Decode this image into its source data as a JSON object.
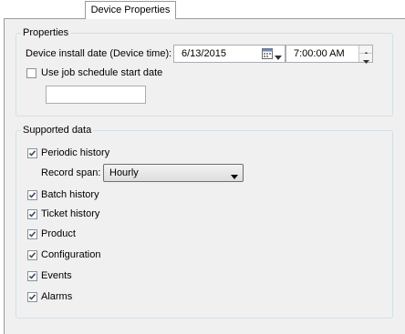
{
  "tab": {
    "label": "Device Properties"
  },
  "properties": {
    "legend": "Properties",
    "install_date_label": "Device install date (Device time):",
    "date_value": "6/13/2015",
    "time_value": "7:00:00 AM",
    "use_job_schedule": {
      "label": "Use job schedule start date",
      "checked": false
    },
    "extra_input_value": ""
  },
  "supported": {
    "legend": "Supported data",
    "periodic_history": {
      "label": "Periodic history",
      "checked": true
    },
    "record_span_label": "Record span:",
    "record_span_value": "Hourly",
    "batch_history": {
      "label": "Batch history",
      "checked": true
    },
    "ticket_history": {
      "label": "Ticket history",
      "checked": true
    },
    "product": {
      "label": "Product",
      "checked": true
    },
    "configuration": {
      "label": "Configuration",
      "checked": true
    },
    "events": {
      "label": "Events",
      "checked": true
    },
    "alarms": {
      "label": "Alarms",
      "checked": true
    }
  },
  "icons": {
    "calendar": "calendar-icon",
    "dropdown": "chevron-down-icon",
    "spin_up": "spin-up-icon",
    "spin_down": "spin-down-icon",
    "check": "check-icon"
  },
  "colors": {
    "panel_bg": "#f0f0f0",
    "group_border": "#d5dfe5",
    "check": "#3c4d69"
  }
}
